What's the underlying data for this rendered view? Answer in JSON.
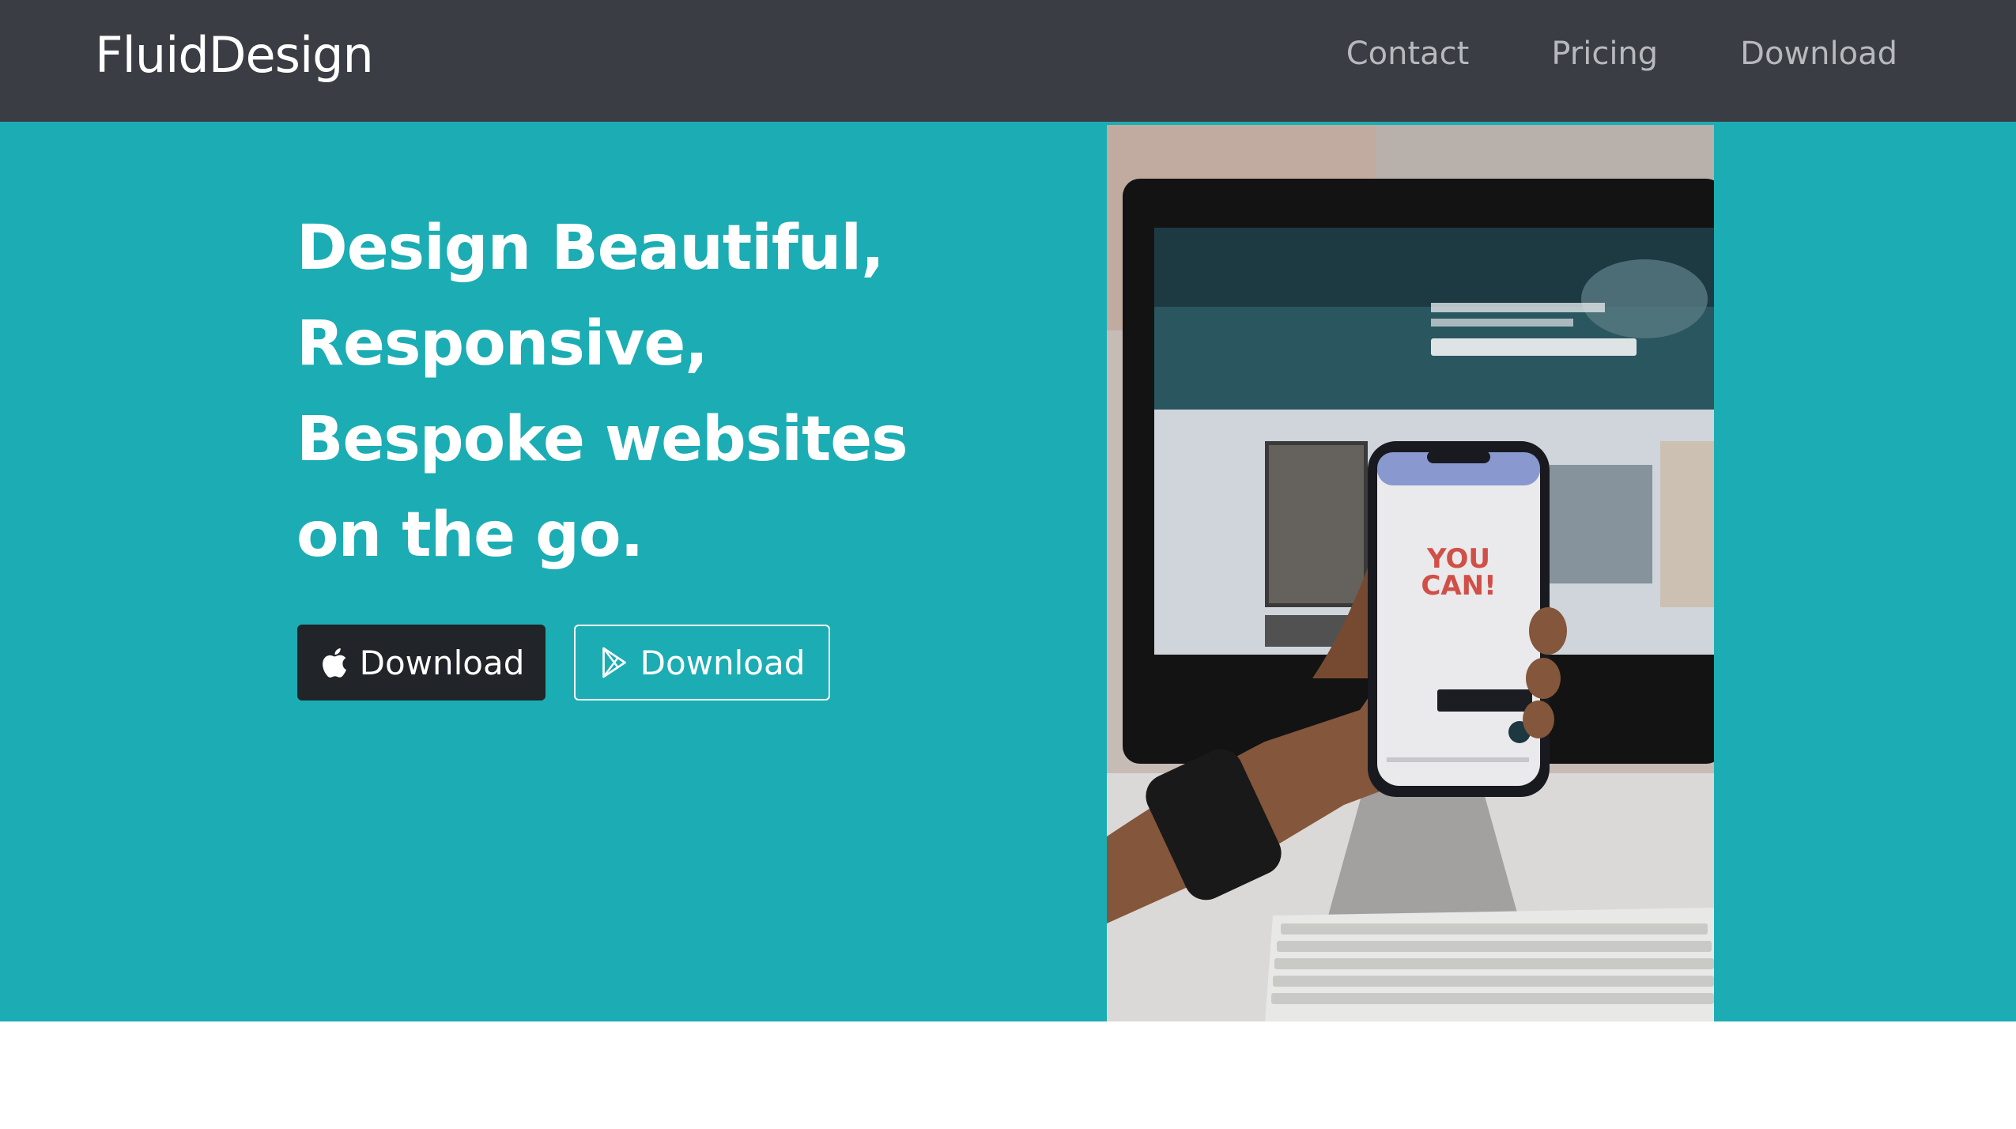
{
  "navbar": {
    "brand": "FluidDesign",
    "links": [
      {
        "label": "Contact"
      },
      {
        "label": "Pricing"
      },
      {
        "label": "Download"
      }
    ],
    "background": "#3a3d44"
  },
  "hero": {
    "title_lines": [
      "Design Beautiful,",
      "Responsive,",
      "Bespoke websites",
      "on the go."
    ],
    "background": "#1badb3",
    "buttons": [
      {
        "label": "Download",
        "icon": "apple-icon",
        "style": "dark"
      },
      {
        "label": "Download",
        "icon": "google-play-icon",
        "style": "outline"
      }
    ],
    "image": {
      "description_icon": "phone-and-monitor-photo",
      "phone_text_line1": "YOU",
      "phone_text_line2": "CAN!"
    }
  }
}
